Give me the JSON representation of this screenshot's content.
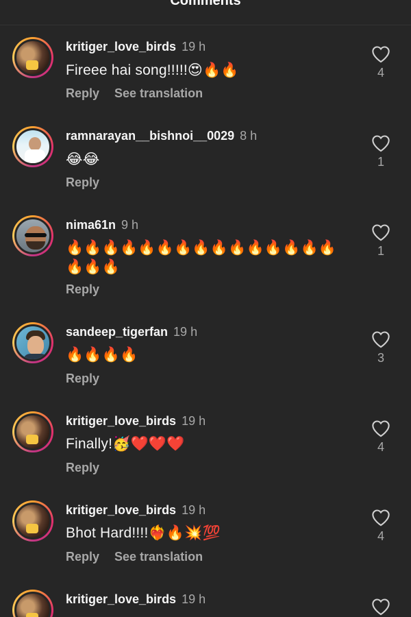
{
  "header": {
    "title": "Comments"
  },
  "reply_label": "Reply",
  "translation_label": "See translation",
  "comments": [
    {
      "username": "kritiger_love_birds",
      "time": "19 h",
      "text": "Fireee hai song!!!!!😍🔥🔥",
      "likes": "4",
      "show_translation": true,
      "avatar": "kritiger-photo"
    },
    {
      "username": "ramnarayan__bishnoi__0029",
      "time": "8 h",
      "text": "😂😂",
      "likes": "1",
      "show_translation": false,
      "avatar": "ramnarayan-photo"
    },
    {
      "username": "nima61n",
      "time": "9 h",
      "text": "🔥🔥🔥🔥🔥🔥🔥🔥🔥🔥🔥🔥🔥🔥🔥🔥🔥🔥",
      "likes": "1",
      "show_translation": false,
      "avatar": "nima-photo"
    },
    {
      "username": "sandeep_tigerfan",
      "time": "19 h",
      "text": "🔥🔥🔥🔥",
      "likes": "3",
      "show_translation": false,
      "avatar": "sandeep-photo"
    },
    {
      "username": "kritiger_love_birds",
      "time": "19 h",
      "text": "Finally!🥳❤️❤️❤️",
      "likes": "4",
      "show_translation": false,
      "avatar": "kritiger-photo"
    },
    {
      "username": "kritiger_love_birds",
      "time": "19 h",
      "text": "Bhot Hard!!!!❤️‍🔥🔥💥💯",
      "likes": "4",
      "show_translation": true,
      "avatar": "kritiger-photo"
    },
    {
      "username": "kritiger_love_birds",
      "time": "19 h",
      "text": "",
      "likes": "",
      "show_translation": false,
      "avatar": "kritiger-photo"
    }
  ]
}
